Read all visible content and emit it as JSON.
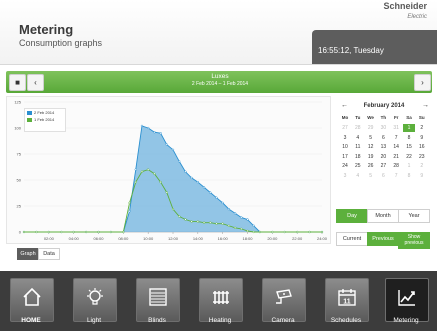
{
  "header": {
    "title": "Metering",
    "subtitle": "Consumption graphs",
    "brand": "Schneider",
    "brand_sub": "Electric",
    "clock": "16:55:12, Tuesday"
  },
  "toolbar": {
    "title": "Luxes",
    "range": "2 Feb 2014 – 1 Feb 2014",
    "menu_icon": "menu-icon",
    "prev_icon": "chevron-left-icon",
    "next_icon": "chevron-right-icon"
  },
  "tabs": {
    "graph": "Graph",
    "data": "Data"
  },
  "legend": [
    {
      "label": "2 Feb 2014",
      "color": "#2a8fd0"
    },
    {
      "label": "1 Feb 2014",
      "color": "#5cb03c"
    }
  ],
  "chart_data": {
    "type": "area",
    "title": "",
    "x": [
      "02:00",
      "04:00",
      "06:00",
      "08:00",
      "10:00",
      "12:00",
      "14:00",
      "16:00",
      "18:00",
      "20:00",
      "22:00",
      "24:00"
    ],
    "ylim": [
      0,
      125
    ],
    "yticks": [
      "0",
      "25",
      "50",
      "75",
      "100",
      "125"
    ],
    "series": [
      {
        "name": "2 Feb 2014",
        "color": "#2a8fd0",
        "points": [
          [
            0,
            0
          ],
          [
            1,
            0
          ],
          [
            2,
            0
          ],
          [
            3,
            0
          ],
          [
            4,
            0
          ],
          [
            5,
            0
          ],
          [
            6,
            0
          ],
          [
            7,
            0
          ],
          [
            8,
            0
          ],
          [
            8.5,
            20
          ],
          [
            9,
            60
          ],
          [
            9.5,
            102
          ],
          [
            10,
            100
          ],
          [
            10.5,
            96
          ],
          [
            11,
            95
          ],
          [
            11.5,
            84
          ],
          [
            12,
            79
          ],
          [
            12.5,
            68
          ],
          [
            13,
            58
          ],
          [
            13.5,
            52
          ],
          [
            14,
            48
          ],
          [
            14.5,
            43
          ],
          [
            15,
            38
          ],
          [
            15.5,
            33
          ],
          [
            16,
            28
          ],
          [
            16.5,
            22
          ],
          [
            17,
            18
          ],
          [
            17.5,
            14
          ],
          [
            18,
            12
          ],
          [
            18.5,
            6
          ],
          [
            19,
            0
          ],
          [
            20,
            0
          ],
          [
            21,
            0
          ],
          [
            22,
            0
          ],
          [
            23,
            0
          ],
          [
            24,
            0
          ]
        ]
      },
      {
        "name": "1 Feb 2014",
        "color": "#5cb03c",
        "points": [
          [
            0,
            0
          ],
          [
            1,
            0
          ],
          [
            2,
            0
          ],
          [
            3,
            0
          ],
          [
            4,
            0
          ],
          [
            5,
            0
          ],
          [
            6,
            0
          ],
          [
            7,
            0
          ],
          [
            8,
            0
          ],
          [
            8.5,
            28
          ],
          [
            9,
            48
          ],
          [
            9.5,
            58
          ],
          [
            10,
            60
          ],
          [
            10.5,
            56
          ],
          [
            11,
            48
          ],
          [
            11.5,
            38
          ],
          [
            12,
            22
          ],
          [
            12.5,
            15
          ],
          [
            13,
            12
          ],
          [
            13.5,
            10
          ],
          [
            14,
            10
          ],
          [
            14.5,
            9
          ],
          [
            15,
            9
          ],
          [
            15.5,
            8
          ],
          [
            16,
            8
          ],
          [
            16.5,
            6
          ],
          [
            17,
            4
          ],
          [
            17.5,
            3
          ],
          [
            18,
            1
          ],
          [
            18.5,
            0
          ],
          [
            19,
            0
          ],
          [
            20,
            0
          ],
          [
            21,
            0
          ],
          [
            22,
            0
          ],
          [
            23,
            0
          ],
          [
            24,
            0
          ]
        ]
      }
    ]
  },
  "calendar": {
    "title": "February 2014",
    "weekdays": [
      "Mo",
      "Tu",
      "We",
      "Th",
      "Fr",
      "Sa",
      "Su"
    ],
    "rows": [
      [
        "27",
        "28",
        "29",
        "30",
        "31",
        "1",
        "2"
      ],
      [
        "3",
        "4",
        "5",
        "6",
        "7",
        "8",
        "9"
      ],
      [
        "10",
        "11",
        "12",
        "13",
        "14",
        "15",
        "16"
      ],
      [
        "17",
        "18",
        "19",
        "20",
        "21",
        "22",
        "23"
      ],
      [
        "24",
        "25",
        "26",
        "27",
        "28",
        "1",
        "2"
      ],
      [
        "3",
        "4",
        "5",
        "6",
        "7",
        "8",
        "9"
      ]
    ],
    "selected_day": "1",
    "periods": [
      "Day",
      "Month",
      "Year"
    ],
    "active_period": "Day",
    "compare": [
      "Current",
      "Previous",
      "Show previous"
    ],
    "active_compare": "Previous"
  },
  "nav": [
    {
      "label": "HOME",
      "icon": "home-icon"
    },
    {
      "label": "Light",
      "icon": "lightbulb-icon"
    },
    {
      "label": "Blinds",
      "icon": "blinds-icon"
    },
    {
      "label": "Heating",
      "icon": "radiator-icon"
    },
    {
      "label": "Camera",
      "icon": "camera-icon"
    },
    {
      "label": "Schedules",
      "icon": "calendar-icon"
    },
    {
      "label": "Metering",
      "icon": "chart-icon"
    }
  ],
  "nav_active": "Metering"
}
